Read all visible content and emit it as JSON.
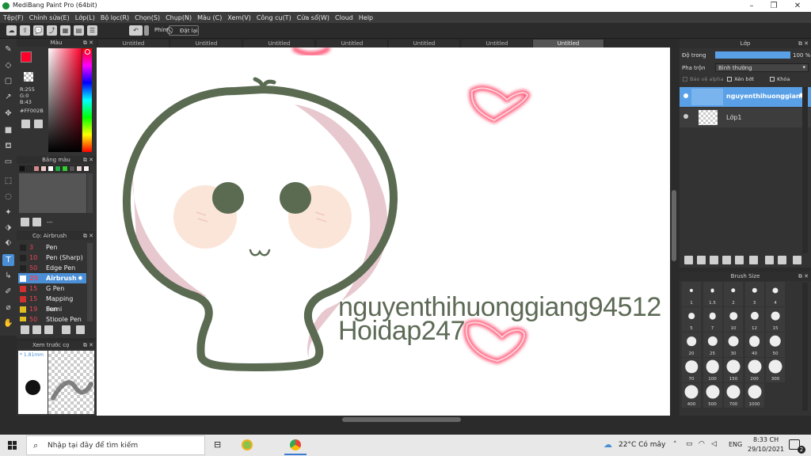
{
  "window": {
    "title": "MediBang Paint Pro (64bit)"
  },
  "menu": [
    "Tệp(F)",
    "Chỉnh sửa(E)",
    "Lớp(L)",
    "Bộ lọc(R)",
    "Chọn(S)",
    "Chụp(N)",
    "Màu (C)",
    "Xem(V)",
    "Công cụ(T)",
    "Cửa sổ(W)",
    "Cloud",
    "Help"
  ],
  "toolbar": {
    "key_label": "Phím",
    "reset_label": "Đặt lại"
  },
  "color_panel": {
    "title": "Màu",
    "r": "R:255",
    "g": "G:0",
    "b": "B:43",
    "hex": "#FF002B",
    "current_color": "#ff002b"
  },
  "palette_panel": {
    "title": "Bảng màu",
    "dash": "---",
    "swatches": [
      "#111111",
      "#2a2a2a",
      "#d08888",
      "#f0c8c8",
      "#ffffff",
      "#22aa44",
      "#33cc33",
      "#555555",
      "#e6d0d0",
      "#f8f0f0"
    ]
  },
  "brush_panel": {
    "title": "Cọ: Airbrush",
    "items": [
      {
        "size": "3",
        "name": "Pen",
        "color": "#222222"
      },
      {
        "size": "10",
        "name": "Pen (Sharp)",
        "color": "#222222"
      },
      {
        "size": "50",
        "name": "Edge Pen",
        "color": "#222222"
      },
      {
        "size": "25",
        "name": "Airbrush",
        "color": "#ffffff"
      },
      {
        "size": "15",
        "name": "G Pen",
        "color": "#d03030"
      },
      {
        "size": "15",
        "name": "Mapping Pen",
        "color": "#d03030"
      },
      {
        "size": "19",
        "name": "Sumi",
        "color": "#e0c020"
      },
      {
        "size": "50",
        "name": "Stipple Pen",
        "color": "#e0c020"
      }
    ]
  },
  "preview_panel": {
    "title": "Xem trước cọ",
    "size": "1.81mm"
  },
  "tabs": [
    "Untitled",
    "Untitled",
    "Untitled",
    "Untitled",
    "Untitled",
    "Untitled",
    "Untitled"
  ],
  "canvas": {
    "watermark_line1": "nguyenthihuonggiang94512",
    "watermark_line2": "Hoidap247"
  },
  "layer_panel": {
    "title": "Lớp",
    "opacity_label": "Độ trong",
    "opacity_value": "100 %",
    "opacity_fraction": 1.0,
    "blend_label": "Pha trộn",
    "blend_value": "Bình thường",
    "protect_alpha": "Bảo vệ alpha",
    "clipping": "Xén bớt",
    "lock": "Khóa",
    "layers": [
      {
        "name": "nguyenthihuonggiang94512",
        "selected": true
      },
      {
        "name": "Lớp1",
        "selected": false
      }
    ]
  },
  "brush_size_panel": {
    "title": "Brush Size",
    "sizes": [
      "1",
      "1.5",
      "2",
      "3",
      "4",
      "5",
      "7",
      "10",
      "12",
      "15",
      "20",
      "25",
      "30",
      "40",
      "50",
      "70",
      "100",
      "150",
      "200",
      "300",
      "400",
      "500",
      "700",
      "1000"
    ]
  },
  "taskbar": {
    "search_placeholder": "Nhập tại đây để tìm kiếm",
    "weather": "22°C  Có mây",
    "lang": "ENG",
    "time": "8:33 CH",
    "date": "29/10/2021",
    "notif_count": "2"
  }
}
